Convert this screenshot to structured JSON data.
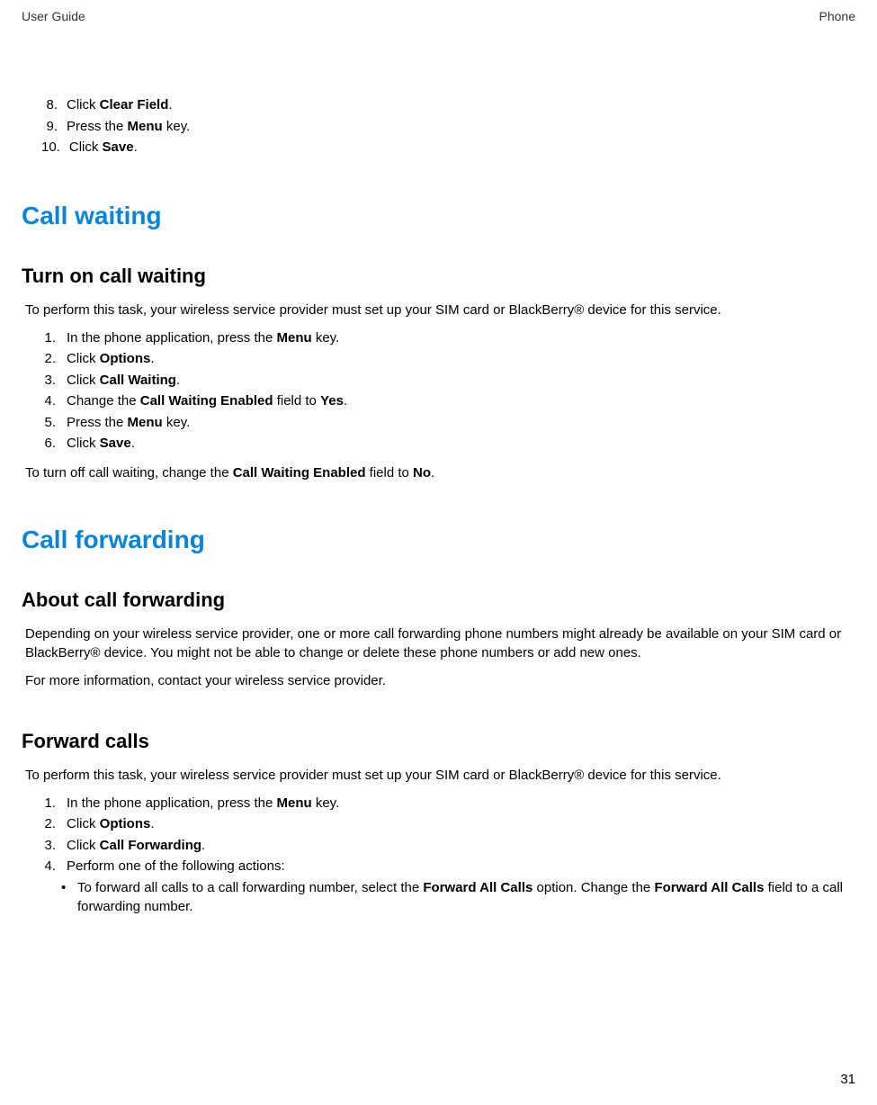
{
  "header": {
    "left": "User Guide",
    "right": "Phone"
  },
  "initial_steps": [
    {
      "num": "8.",
      "pre": "Click ",
      "bold": "Clear Field",
      "post": "."
    },
    {
      "num": "9.",
      "pre": "Press the ",
      "bold": "Menu",
      "post": " key."
    },
    {
      "num": "10.",
      "pre": "Click ",
      "bold": "Save",
      "post": "."
    }
  ],
  "section_cw": {
    "title": "Call waiting",
    "sub1": {
      "title": "Turn on call waiting",
      "intro": "To perform this task, your wireless service provider must set up your SIM card or BlackBerry® device for this service.",
      "steps": [
        {
          "num": "1.",
          "pre": "In the phone application, press the ",
          "bold": "Menu",
          "post": " key."
        },
        {
          "num": "2.",
          "pre": "Click ",
          "bold": "Options",
          "post": "."
        },
        {
          "num": "3.",
          "pre": "Click ",
          "bold": "Call Waiting",
          "post": "."
        },
        {
          "num": "4.",
          "pre": "Change the ",
          "bold": "Call Waiting Enabled",
          "post_pre": " field to ",
          "bold2": "Yes",
          "post": "."
        },
        {
          "num": "5.",
          "pre": "Press the ",
          "bold": "Menu",
          "post": " key."
        },
        {
          "num": "6.",
          "pre": "Click ",
          "bold": "Save",
          "post": "."
        }
      ],
      "turn_off": {
        "pre": "To turn off call waiting, change the ",
        "bold": "Call Waiting Enabled",
        "mid": " field to ",
        "bold2": "No",
        "post": "."
      }
    }
  },
  "section_cf": {
    "title": "Call forwarding",
    "about": {
      "title": "About call forwarding",
      "para1": "Depending on your wireless service provider, one or more call forwarding phone numbers might already be available on your SIM card or BlackBerry® device. You might not be able to change or delete these phone numbers or add new ones.",
      "para2": "For more information, contact your wireless service provider."
    },
    "forward": {
      "title": "Forward calls",
      "intro": "To perform this task, your wireless service provider must set up your SIM card or BlackBerry® device for this service.",
      "steps": [
        {
          "num": "1.",
          "pre": "In the phone application, press the ",
          "bold": "Menu",
          "post": " key."
        },
        {
          "num": "2.",
          "pre": "Click ",
          "bold": "Options",
          "post": "."
        },
        {
          "num": "3.",
          "pre": "Click ",
          "bold": "Call Forwarding",
          "post": "."
        },
        {
          "num": "4.",
          "text": "Perform one of the following actions:"
        }
      ],
      "bullet": {
        "dot": "•",
        "pre": "To forward all calls to a call forwarding number, select the ",
        "bold1": "Forward All Calls",
        "mid1": " option. Change the ",
        "bold2": "Forward All Calls",
        "mid2": " field to a call forwarding number."
      }
    }
  },
  "page_number": "31"
}
